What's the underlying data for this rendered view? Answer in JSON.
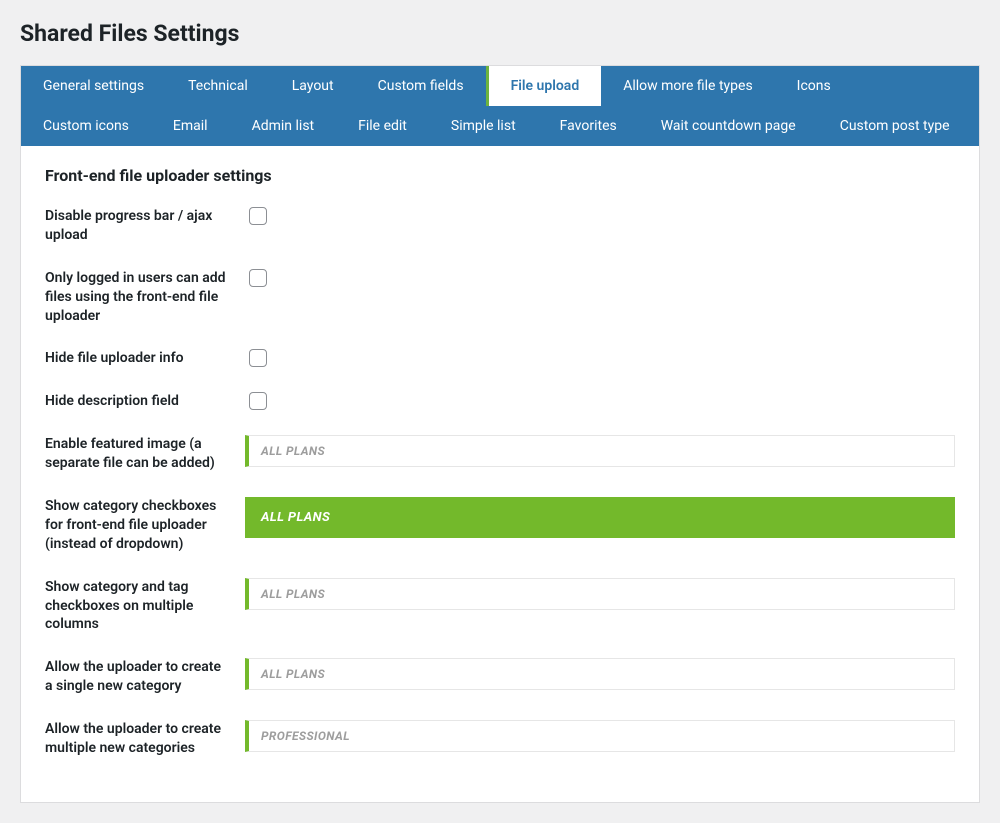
{
  "page": {
    "title": "Shared Files Settings"
  },
  "tabs": [
    {
      "label": "General settings",
      "active": false
    },
    {
      "label": "Technical",
      "active": false
    },
    {
      "label": "Layout",
      "active": false
    },
    {
      "label": "Custom fields",
      "active": false
    },
    {
      "label": "File upload",
      "active": true
    },
    {
      "label": "Allow more file types",
      "active": false
    },
    {
      "label": "Icons",
      "active": false
    },
    {
      "label": "Custom icons",
      "active": false
    },
    {
      "label": "Email",
      "active": false
    },
    {
      "label": "Admin list",
      "active": false
    },
    {
      "label": "File edit",
      "active": false
    },
    {
      "label": "Simple list",
      "active": false
    },
    {
      "label": "Favorites",
      "active": false
    },
    {
      "label": "Wait countdown page",
      "active": false
    },
    {
      "label": "Custom post type",
      "active": false
    }
  ],
  "section": {
    "title": "Front-end file uploader settings"
  },
  "settings": [
    {
      "label": "Disable progress bar / ajax upload",
      "type": "checkbox",
      "checked": false
    },
    {
      "label": "Only logged in users can add files using the front-end file uploader",
      "type": "checkbox",
      "checked": false
    },
    {
      "label": "Hide file uploader info",
      "type": "checkbox",
      "checked": false
    },
    {
      "label": "Hide description field",
      "type": "checkbox",
      "checked": false
    },
    {
      "label": "Enable featured image (a separate file can be added)",
      "type": "plan",
      "plan": "ALL PLANS",
      "active": false
    },
    {
      "label": "Show category checkboxes for front-end file uploader (instead of dropdown)",
      "type": "plan",
      "plan": "ALL PLANS",
      "active": true
    },
    {
      "label": "Show category and tag checkboxes on multiple columns",
      "type": "plan",
      "plan": "ALL PLANS",
      "active": false
    },
    {
      "label": "Allow the uploader to create a single new category",
      "type": "plan",
      "plan": "ALL PLANS",
      "active": false
    },
    {
      "label": "Allow the uploader to create multiple new categories",
      "type": "plan",
      "plan": "PROFESSIONAL",
      "active": false
    }
  ]
}
